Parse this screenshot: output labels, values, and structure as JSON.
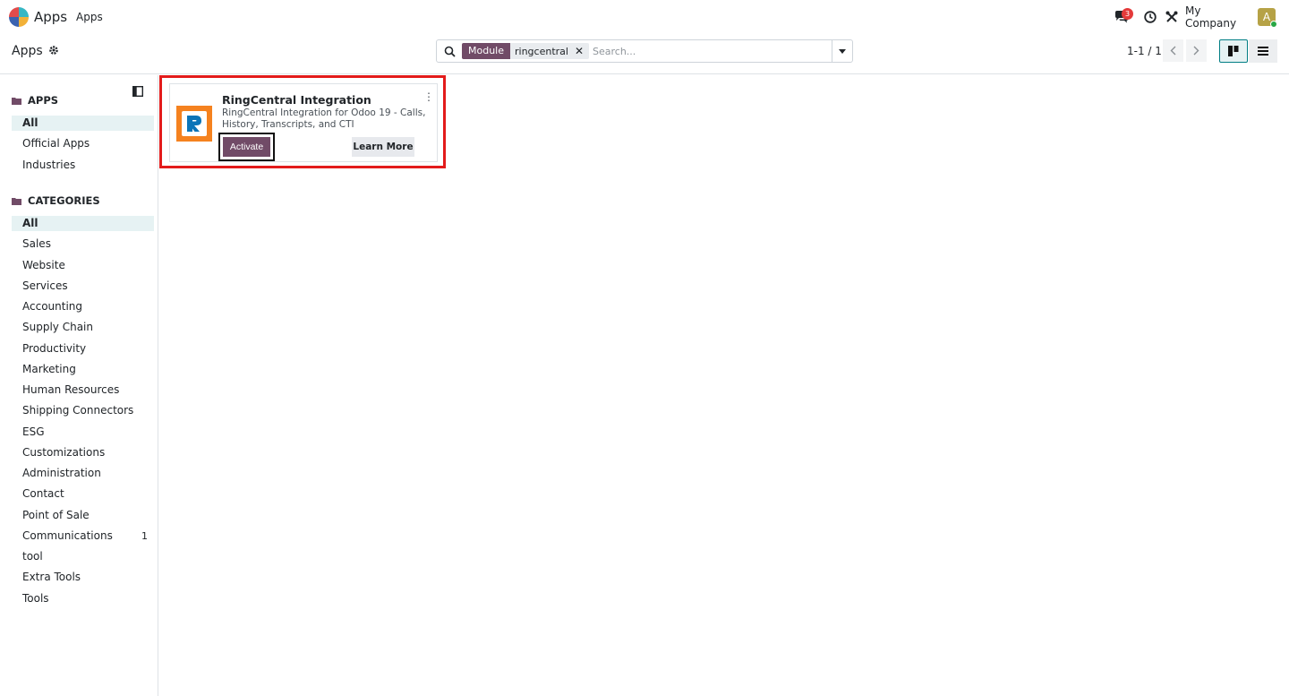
{
  "navbar": {
    "app_title": "Apps",
    "menu": [
      "Apps"
    ],
    "chat_badge": "3",
    "company": "My Company",
    "avatar_letter": "A"
  },
  "control": {
    "breadcrumb": "Apps",
    "search": {
      "facet_label": "Module",
      "facet_value": "ringcentral",
      "placeholder": "Search..."
    },
    "pager": "1-1 / 1"
  },
  "sidebar": {
    "apps_heading": "APPS",
    "apps": [
      {
        "label": "All",
        "active": true
      },
      {
        "label": "Official Apps"
      },
      {
        "label": "Industries"
      }
    ],
    "categories_heading": "CATEGORIES",
    "categories": [
      {
        "label": "All",
        "active": true
      },
      {
        "label": "Sales"
      },
      {
        "label": "Website"
      },
      {
        "label": "Services"
      },
      {
        "label": "Accounting"
      },
      {
        "label": "Supply Chain"
      },
      {
        "label": "Productivity"
      },
      {
        "label": "Marketing"
      },
      {
        "label": "Human Resources"
      },
      {
        "label": "Shipping Connectors"
      },
      {
        "label": "ESG"
      },
      {
        "label": "Customizations"
      },
      {
        "label": "Administration"
      },
      {
        "label": "Contact"
      },
      {
        "label": "Point of Sale"
      },
      {
        "label": "Communications",
        "count": "1"
      },
      {
        "label": "tool"
      },
      {
        "label": "Extra Tools"
      },
      {
        "label": "Tools"
      }
    ]
  },
  "card": {
    "title": "RingCentral Integration",
    "description": "RingCentral Integration for Odoo 19 - Calls, History, Transcripts, and CTI",
    "activate_label": "Activate",
    "learn_more_label": "Learn More"
  },
  "colors": {
    "primary": "#714b67",
    "accent": "#017e84",
    "highlight": "#e31b1b",
    "logo_orange": "#f5821f",
    "logo_blue": "#0b74b8"
  },
  "icons": [
    "odoo-apps-logo",
    "chat-icon",
    "clock-icon",
    "tools-icon",
    "gear-icon",
    "search-icon",
    "caret-down-icon",
    "chevron-left-icon",
    "chevron-right-icon",
    "kanban-view-icon",
    "list-view-icon",
    "folder-icon",
    "panel-toggle-icon",
    "kebab-menu-icon",
    "ringcentral-logo"
  ]
}
